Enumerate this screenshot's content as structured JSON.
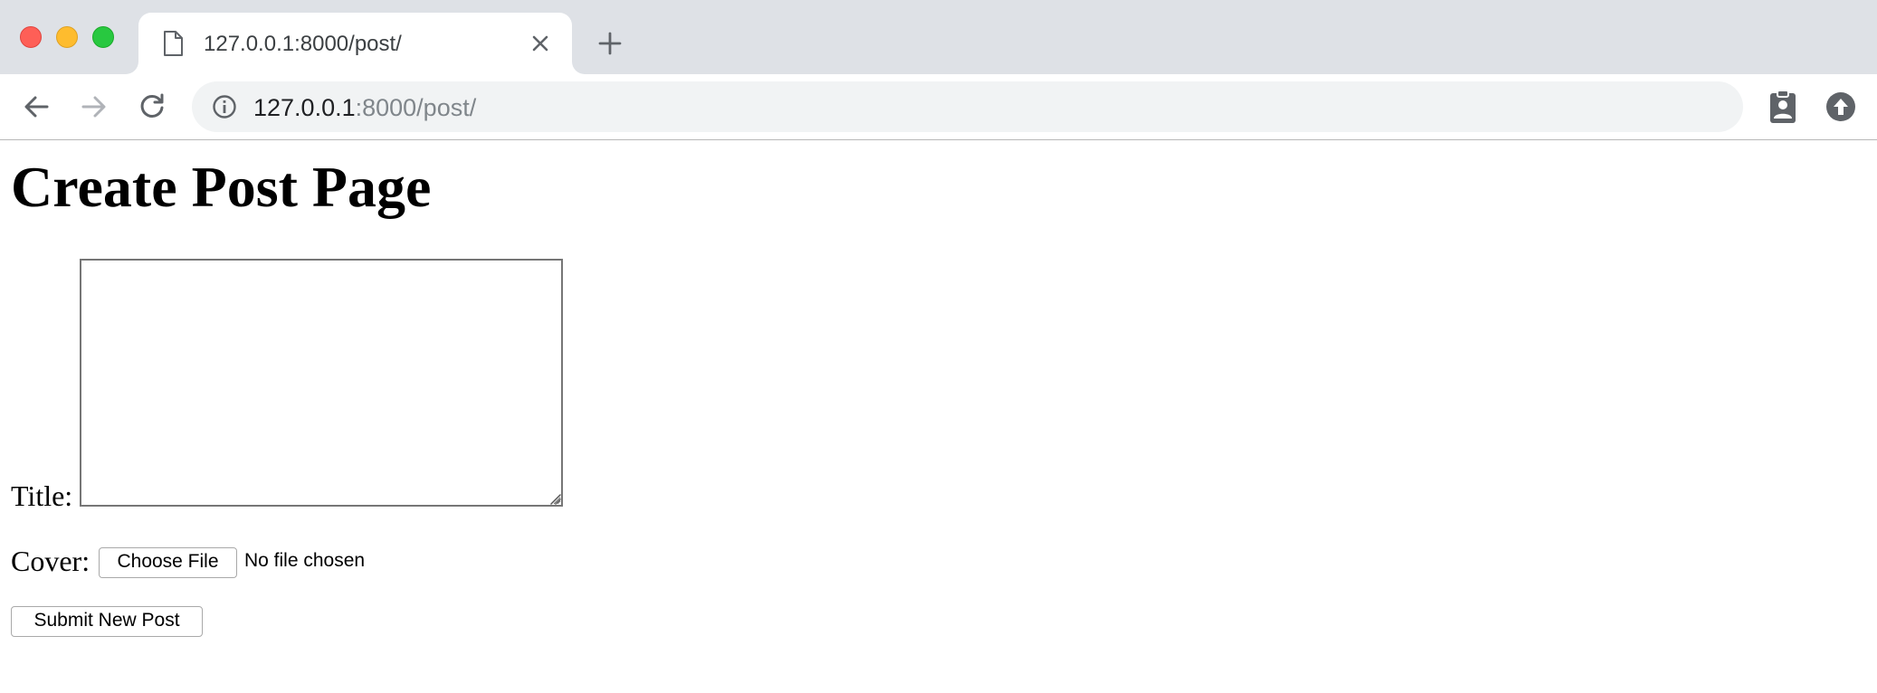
{
  "browser": {
    "tab": {
      "title": "127.0.0.1:8000/post/",
      "favicon": "document-icon"
    },
    "address_bar": {
      "host": "127.0.0.1",
      "rest": ":8000/post/"
    },
    "icons": {
      "back": "arrow-left-icon",
      "forward": "arrow-right-icon",
      "reload": "reload-icon",
      "info": "info-icon",
      "close_tab": "close-icon",
      "new_tab": "plus-icon",
      "extension_1": "clipboard-person-icon",
      "extension_2": "upload-circle-icon"
    },
    "colors": {
      "tabstrip_bg": "#dee1e6",
      "omnibox_bg": "#f1f3f4",
      "url_host": "#202124",
      "url_rest": "#80868b",
      "traffic_red": "#fe5f57",
      "traffic_yellow": "#febc2e",
      "traffic_green": "#28c840"
    }
  },
  "page": {
    "heading": "Create Post Page",
    "form": {
      "title_label": "Title:",
      "title_value": "",
      "cover_label": "Cover:",
      "choose_file_label": "Choose File",
      "file_status": "No file chosen",
      "submit_label": "Submit New Post"
    }
  }
}
